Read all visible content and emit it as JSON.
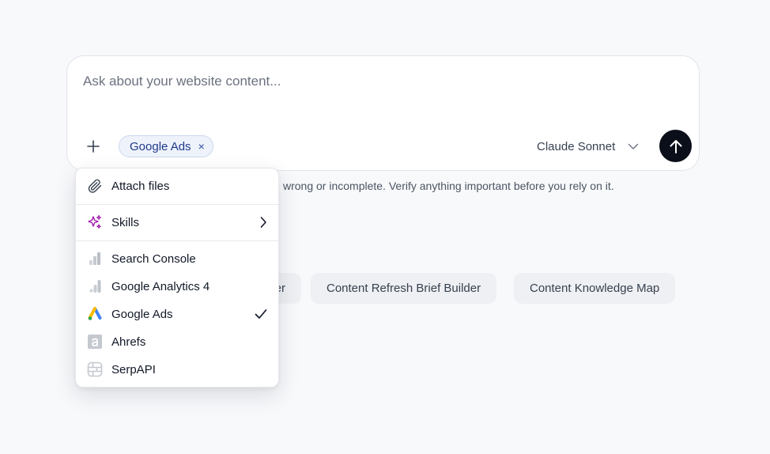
{
  "composer": {
    "placeholder": "Ask about your website content...",
    "attached_chip": "Google Ads",
    "chip_remove_glyph": "×",
    "model": "Claude Sonnet",
    "icons": {
      "plus": "plus-icon",
      "chevron": "chevron-down-icon",
      "send": "arrow-up-icon",
      "close": "close-icon"
    }
  },
  "disclaimer": "wrong or incomplete. Verify anything important before you rely on it.",
  "suggestions": [
    "er",
    "Content Refresh Brief Builder",
    "Content Knowledge Map"
  ],
  "menu": {
    "attach_label": "Attach files",
    "skills_label": "Skills",
    "integrations": [
      {
        "label": "Search Console",
        "icon": "search-console-icon",
        "selected": false
      },
      {
        "label": "Google Analytics 4",
        "icon": "google-analytics-icon",
        "selected": false
      },
      {
        "label": "Google Ads",
        "icon": "google-ads-icon",
        "selected": true
      },
      {
        "label": "Ahrefs",
        "icon": "ahrefs-icon",
        "selected": false
      },
      {
        "label": "SerpAPI",
        "icon": "serpapi-icon",
        "selected": false
      }
    ]
  },
  "colors": {
    "send_button": "#0b0f19",
    "chip_bg": "#eef2fb",
    "chip_text": "#1e3a8a",
    "skills_icon": "#a21caf",
    "google_blue": "#4285f4",
    "google_yellow": "#fbbc04",
    "google_green": "#34a853"
  }
}
